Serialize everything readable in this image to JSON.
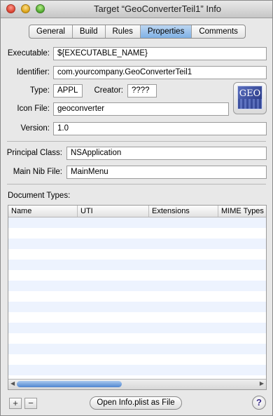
{
  "window": {
    "title": "Target “GeoConverterTeil1” Info"
  },
  "tabs": [
    "General",
    "Build",
    "Rules",
    "Properties",
    "Comments"
  ],
  "active_tab": "Properties",
  "form": {
    "executable": {
      "label": "Executable:",
      "value": "${EXECUTABLE_NAME}"
    },
    "identifier": {
      "label": "Identifier:",
      "value": "com.yourcompany.GeoConverterTeil1"
    },
    "type": {
      "label": "Type:",
      "value": "APPL"
    },
    "creator": {
      "label": "Creator:",
      "value": "????"
    },
    "icon_file": {
      "label": "Icon File:",
      "value": "geoconverter"
    },
    "icon_preview_text": "GEO",
    "version": {
      "label": "Version:",
      "value": "1.0"
    },
    "principal_class": {
      "label": "Principal Class:",
      "value": "NSApplication"
    },
    "main_nib_file": {
      "label": "Main Nib File:",
      "value": "MainMenu"
    }
  },
  "document_types": {
    "label": "Document Types:",
    "columns": [
      "Name",
      "UTI",
      "Extensions",
      "MIME Types"
    ],
    "rows": []
  },
  "footer": {
    "add_label": "+",
    "remove_label": "−",
    "open_button": "Open Info.plist as File",
    "help_label": "?"
  },
  "colors": {
    "selection_tab": "#7fb1e5",
    "row_stripe": "#edf3fe"
  }
}
